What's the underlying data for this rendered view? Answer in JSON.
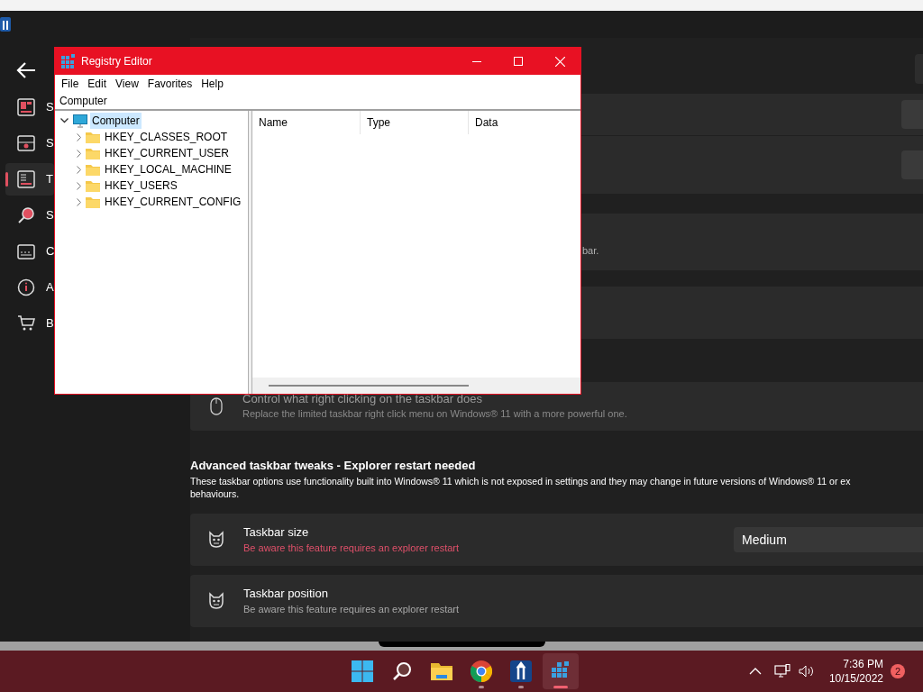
{
  "app_window": {
    "sidebar_items": [
      {
        "label": "S",
        "selected": false
      },
      {
        "label": "S",
        "selected": false
      },
      {
        "label": "T",
        "selected": true
      },
      {
        "label": "S",
        "selected": false
      },
      {
        "label": "C",
        "selected": false
      },
      {
        "label": "A",
        "selected": false
      },
      {
        "label": "B",
        "selected": false
      }
    ]
  },
  "settings_cards": [
    {
      "kind": "button"
    },
    {
      "kind": "button"
    },
    {
      "kind": "text",
      "description": "bar."
    },
    {
      "kind": "blank"
    },
    {
      "kind": "option",
      "title": "Control what right clicking on the taskbar does",
      "description": "Replace the limited taskbar right click menu on Windows® 11 with a more powerful one."
    }
  ],
  "section": {
    "heading": "Advanced taskbar tweaks - Explorer restart needed",
    "description_lines": [
      "These taskbar options use functionality built into Windows® 11 which is not exposed in settings and they may change in future versions of Windows® 11 or ex",
      "behaviours."
    ]
  },
  "tweaks": [
    {
      "title": "Taskbar size",
      "note": "Be aware this feature requires an explorer restart",
      "warning": true,
      "value": "Medium"
    },
    {
      "title": "Taskbar position",
      "note": "Be aware this feature requires an explorer restart",
      "warning": false
    }
  ],
  "registry_editor": {
    "title": "Registry Editor",
    "menu": [
      "File",
      "Edit",
      "View",
      "Favorites",
      "Help"
    ],
    "address": "Computer",
    "tree": {
      "label": "Computer",
      "expanded": true,
      "selected": true,
      "children": [
        {
          "label": "HKEY_CLASSES_ROOT",
          "expanded": false
        },
        {
          "label": "HKEY_CURRENT_USER",
          "expanded": false
        },
        {
          "label": "HKEY_LOCAL_MACHINE",
          "expanded": false
        },
        {
          "label": "HKEY_USERS",
          "expanded": false
        },
        {
          "label": "HKEY_CURRENT_CONFIG",
          "expanded": false
        }
      ]
    },
    "columns": [
      "Name",
      "Type",
      "Data"
    ]
  },
  "taskbar": {
    "apps": [
      {
        "kind": "start",
        "running": false,
        "active": false
      },
      {
        "kind": "search",
        "running": false,
        "active": false
      },
      {
        "kind": "explorer",
        "running": false,
        "active": false
      },
      {
        "kind": "chrome",
        "running": true,
        "active": false
      },
      {
        "kind": "tweaker",
        "running": true,
        "active": false
      },
      {
        "kind": "regedit",
        "running": true,
        "active": true
      }
    ],
    "time": "7:36 PM",
    "date": "10/15/2022",
    "notification_count": "2"
  }
}
